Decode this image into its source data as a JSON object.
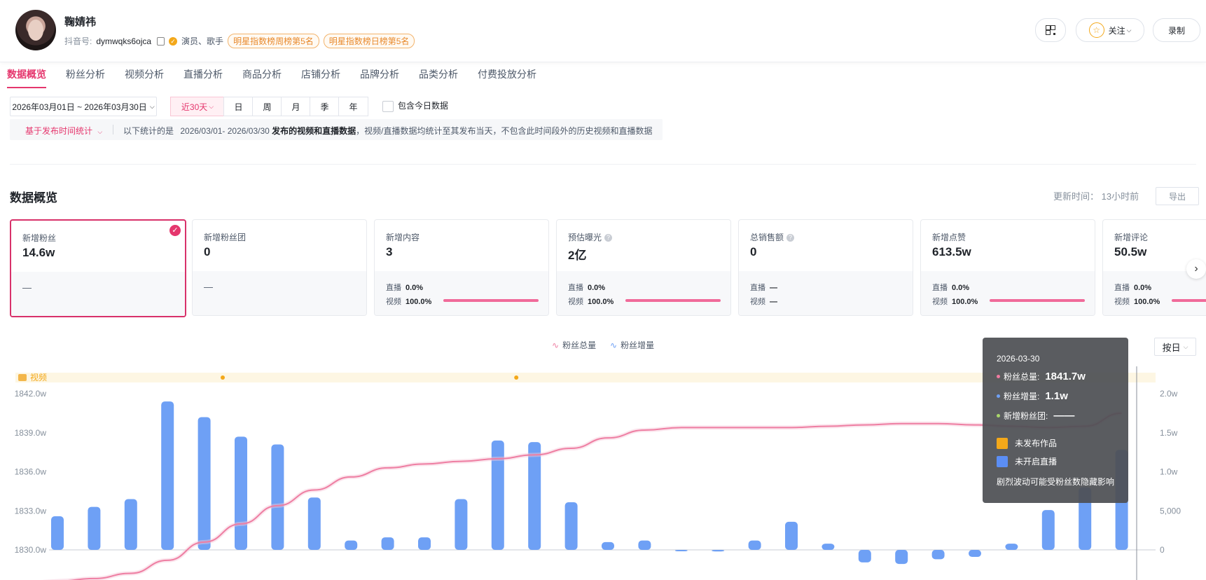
{
  "profile": {
    "name": "鞠婧祎",
    "id_label": "抖音号:",
    "id_value": "dymwqks6ojca",
    "roles": "演员、歌手",
    "tags": [
      "明星指数榜周榜第5名",
      "明星指数榜日榜第5名"
    ]
  },
  "header_actions": {
    "follow": "关注",
    "record": "录制"
  },
  "tabs": [
    "数据概览",
    "粉丝分析",
    "视频分析",
    "直播分析",
    "商品分析",
    "店铺分析",
    "品牌分析",
    "品类分析",
    "付费投放分析"
  ],
  "date_filter": {
    "range": "2026年03月01日 ~ 2026年03月30日",
    "quick": "近30天",
    "periods": [
      "日",
      "周",
      "月",
      "季",
      "年"
    ],
    "include_today": "包含今日数据"
  },
  "info_bar": {
    "dropdown": "基于发布时间统计",
    "text_prefix": "以下统计的是",
    "text_range": "2026/03/01- 2026/03/30",
    "text_bold": "发布的视频和直播数据",
    "text_suffix": "，视频/直播数据均统计至其发布当天，不包含此时间段外的历史视频和直播数据"
  },
  "overview": {
    "title": "数据概览",
    "updated": "更新时间： 13小时前",
    "export": "导出",
    "cards": [
      {
        "label": "新增粉丝",
        "value": "14.6w",
        "foot": "—"
      },
      {
        "label": "新增粉丝团",
        "value": "0",
        "foot": "—"
      },
      {
        "label": "新增内容",
        "value": "3",
        "live_label": "直播",
        "live": "0.0%",
        "video_label": "视频",
        "video": "100.0%",
        "video_share": 1.0
      },
      {
        "label": "预估曝光",
        "value": "2亿",
        "live_label": "直播",
        "live": "0.0%",
        "video_label": "视频",
        "video": "100.0%",
        "video_share": 1.0
      },
      {
        "label": "总销售额",
        "value": "0",
        "live_label": "直播",
        "live": "—",
        "video_label": "视频",
        "video": "—",
        "video_share": 0
      },
      {
        "label": "新增点赞",
        "value": "613.5w",
        "live_label": "直播",
        "live": "0.0%",
        "video_label": "视频",
        "video": "100.0%",
        "video_share": 1.0
      },
      {
        "label": "新增评论",
        "value": "50.5w",
        "live_label": "直播",
        "live": "0.0%",
        "video_label": "视频",
        "video": "100.0%",
        "video_share": 1.0
      }
    ]
  },
  "chart_controls": {
    "by": "按日",
    "video_track": "视频"
  },
  "colors": {
    "accent": "#e5366d",
    "line": "#ee7ea2",
    "bar": "#6ea0f5"
  },
  "chart_data": {
    "type": "bar",
    "series": [
      {
        "name": "粉丝总量",
        "type": "line",
        "axis": "left",
        "values": [
          1827.6,
          1827.8,
          1828.2,
          1829.2,
          1830.6,
          1832.0,
          1833.4,
          1834.6,
          1835.6,
          1836.3,
          1836.6,
          1836.8,
          1837.0,
          1837.3,
          1837.8,
          1838.6,
          1839.2,
          1839.4,
          1839.4,
          1839.4,
          1839.4,
          1839.5,
          1839.6,
          1839.7,
          1839.7,
          1839.6,
          1839.5,
          1839.4,
          1839.5,
          1840.5
        ]
      },
      {
        "name": "粉丝增量",
        "type": "bar",
        "axis": "right",
        "values": [
          4300,
          5500,
          6500,
          19000,
          17000,
          14500,
          13500,
          6700,
          1200,
          1600,
          1600,
          6500,
          14000,
          13800,
          6100,
          1000,
          1200,
          0,
          -200,
          1200,
          3600,
          800,
          -1600,
          -1800,
          -1200,
          -900,
          800,
          5100,
          8000,
          12800
        ]
      },
      {
        "name": "新增粉丝团",
        "type": "line",
        "values": []
      }
    ],
    "video_markers": [
      5,
      13
    ],
    "left_axis": {
      "ticks": [
        "1830.0w",
        "1833.0w",
        "1836.0w",
        "1839.0w",
        "1842.0w"
      ],
      "range": [
        1830.0,
        1842.0
      ]
    },
    "right_axis": {
      "ticks": [
        "0",
        "5,000",
        "1.0w",
        "1.5w",
        "2.0w"
      ],
      "range": [
        0,
        20000
      ]
    },
    "legend": [
      "粉丝总量",
      "粉丝增量"
    ]
  },
  "tooltip": {
    "date": "2026-03-30",
    "rows": [
      {
        "label": "粉丝总量:",
        "value": "1841.7w",
        "color": "#f07aa0"
      },
      {
        "label": "粉丝增量:",
        "value": "1.1w",
        "color": "#6ea0f5"
      },
      {
        "label": "新增粉丝团:",
        "value": "——",
        "color": "#a8d66a"
      }
    ],
    "status": [
      {
        "label": "未发布作品",
        "color": "#f3a81a"
      },
      {
        "label": "未开启直播",
        "color": "#5b8ef5"
      }
    ],
    "note": "剧烈波动可能受粉丝数隐藏影响"
  }
}
